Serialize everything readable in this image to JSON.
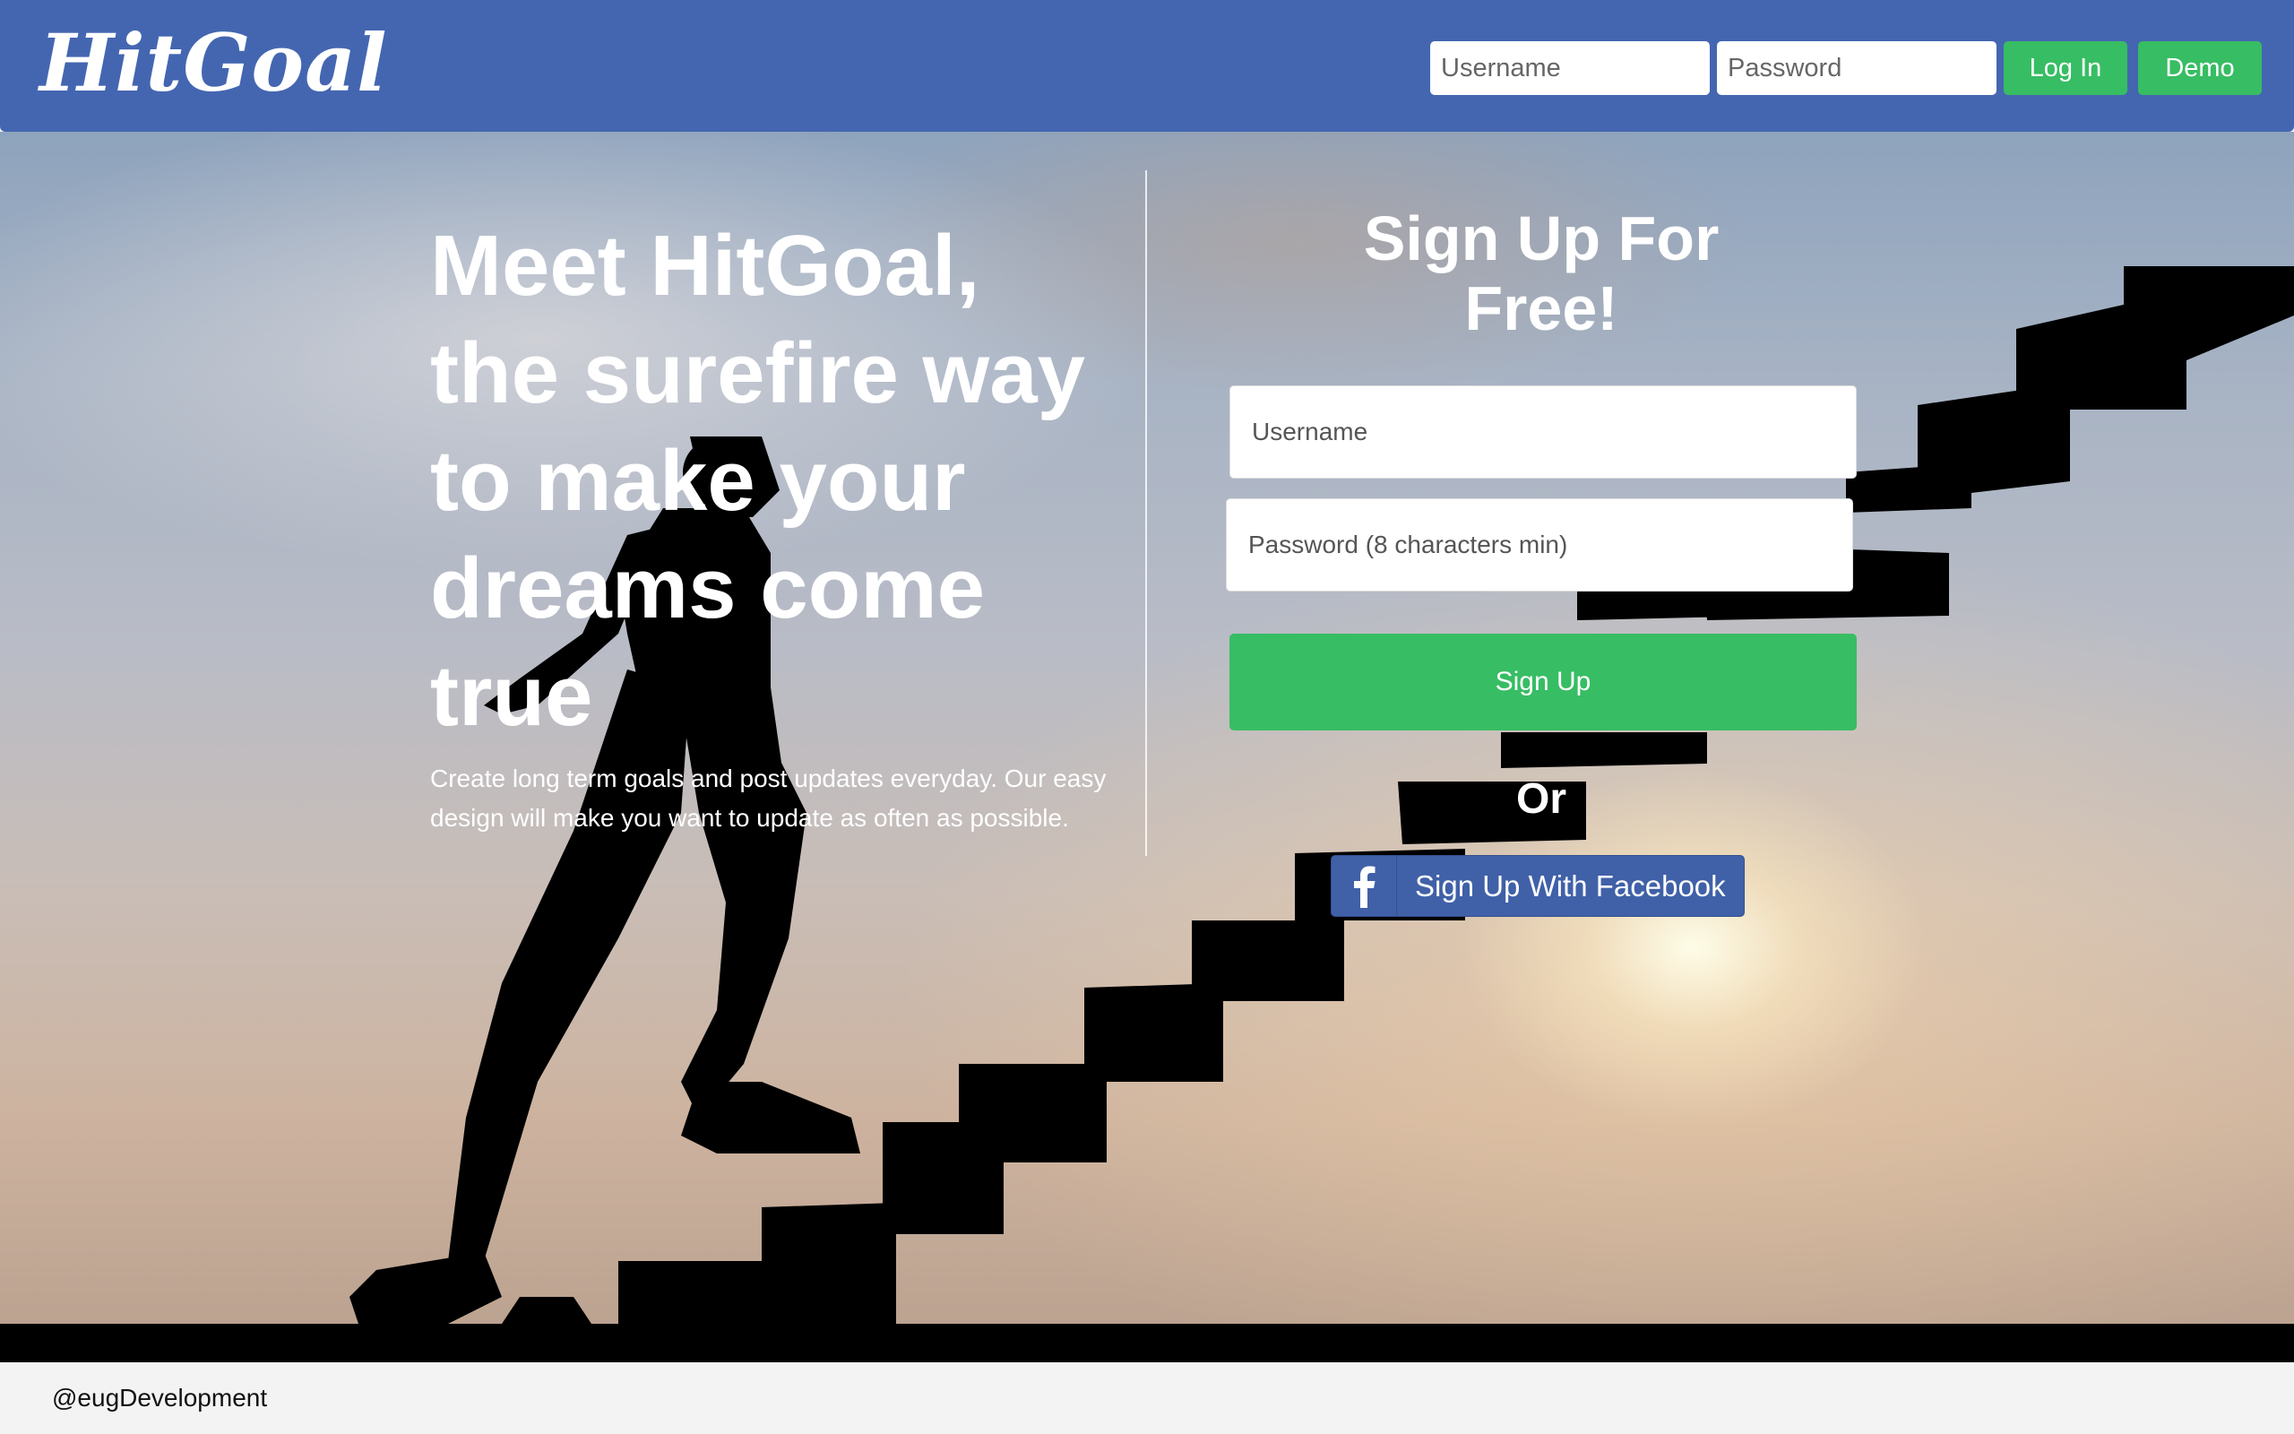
{
  "header": {
    "logo_text": "HitGoal",
    "username_placeholder": "Username",
    "password_placeholder": "Password",
    "login_label": "Log In",
    "demo_label": "Demo"
  },
  "hero": {
    "headline": "Meet HitGoal, the surefire way to make your dreams come true",
    "subtext": "Create long term goals and post updates everyday. Our easy design will make you want to update as often as possible."
  },
  "signup": {
    "title": "Sign Up For Free!",
    "username_placeholder": "Username",
    "password_placeholder": "Password (8 characters min)",
    "submit_label": "Sign Up",
    "or_text": "Or",
    "facebook_label": "Sign Up With Facebook"
  },
  "footer": {
    "handle": "@eugDevelopment"
  },
  "colors": {
    "header_bg": "#4466b1",
    "accent_green": "#37bd63",
    "facebook_blue": "#4061a8",
    "footer_bg": "#f3f3f3"
  },
  "icons": {
    "facebook": "facebook-f-icon"
  }
}
